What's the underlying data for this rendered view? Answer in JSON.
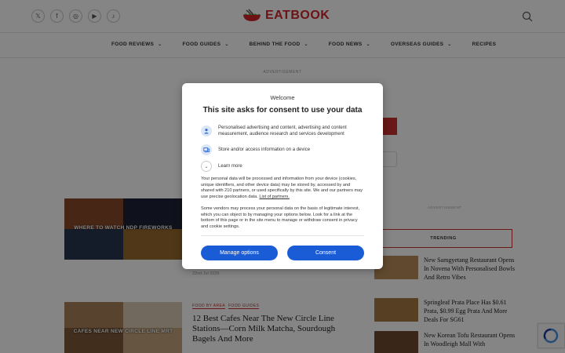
{
  "header": {
    "logo_text": "EATBOOK",
    "social_icons": [
      "x-icon",
      "facebook-icon",
      "instagram-icon",
      "youtube-icon",
      "tiktok-icon"
    ],
    "social_glyphs": [
      "𝕏",
      "f",
      "◎",
      "▶",
      "♪"
    ]
  },
  "nav": {
    "items": [
      {
        "label": "FOOD REVIEWS",
        "has_caret": true
      },
      {
        "label": "FOOD GUIDES",
        "has_caret": true
      },
      {
        "label": "BEHIND THE FOOD",
        "has_caret": true
      },
      {
        "label": "FOOD NEWS",
        "has_caret": true
      },
      {
        "label": "OVERSEAS GUIDES",
        "has_caret": true
      },
      {
        "label": "RECIPES",
        "has_caret": false
      }
    ],
    "caret_glyph": "⌄"
  },
  "ad_label": "ADVERTISEMENT",
  "sidebar": {
    "ad_label": "ADVERTISEMENT",
    "trending_label": "TRENDING",
    "trending": [
      {
        "title": "New Samgyetang Restaurant Opens In Novena With Personalised Bowls And Retro Vibes"
      },
      {
        "title": "Springleaf Prata Place Has $0.61 Prata, $0.99 Egg Prata And More Deals For SG61"
      },
      {
        "title": "New Korean Tofu Restaurant Opens In Woodleigh Mall With"
      }
    ]
  },
  "articles": [
    {
      "image_caption": "WHERE TO WATCH NDP FIREWORKS",
      "date": "22nd Jul 2026"
    },
    {
      "image_caption": "CAFES NEAR NEW CIRCLE LINE MRT",
      "tags": [
        "FOOD BY AREA",
        "FOOD GUIDES"
      ],
      "title": "12 Best Cafes Near The New Circle Line Stations—Corn Milk Matcha, Sourdough Bagels And More"
    }
  ],
  "consent": {
    "welcome": "Welcome",
    "title": "This site asks for consent to use your data",
    "purposes": [
      {
        "icon": "person-icon",
        "text": "Personalised advertising and content, advertising and content measurement, audience research and services development"
      },
      {
        "icon": "device-icon",
        "text": "Store and/or access information on a device"
      }
    ],
    "learn_more": "Learn more",
    "learn_more_glyph": "⌄",
    "paragraph1": "Your personal data will be processed and information from your device (cookies, unique identifiers, and other device data) may be stored by, accessed by and shared with 210 partners, or used specifically by this site. We and our partners may use precise geolocation data.",
    "partners_link": "List of partners.",
    "paragraph2": "Some vendors may process your personal data on the basis of legitimate interest, which you can object to by managing your options below. Look for a link at the bottom of this page or in the site menu to manage or withdraw consent in privacy and cookie settings.",
    "manage_button": "Manage options",
    "consent_button": "Consent"
  },
  "colors": {
    "brand_red": "#d2232a",
    "consent_blue": "#1a5bd6",
    "overlay": "rgba(0,0,0,0.48)"
  }
}
